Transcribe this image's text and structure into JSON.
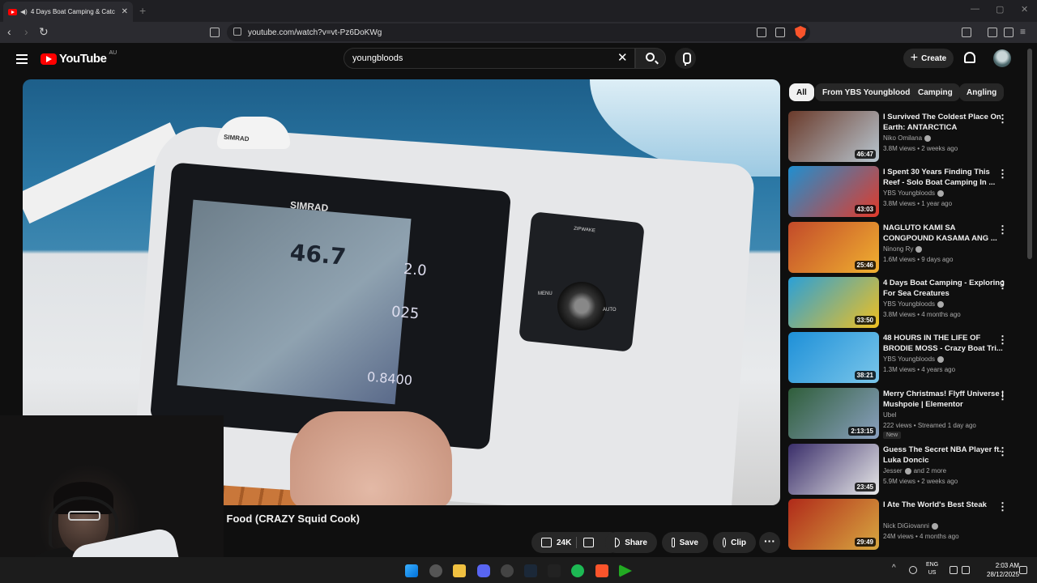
{
  "browser": {
    "tab_title": "4 Days Boat Camping & Catc",
    "url": "youtube.com/watch?v=vt-Pz6DoKWg",
    "new_tab": "+",
    "tab_close": "✕",
    "nav_back": "‹",
    "nav_forward": "›",
    "nav_reload": "↻",
    "win_min": "—",
    "win_max": "▢",
    "win_close": "✕"
  },
  "masthead": {
    "logo_text": "YouTube",
    "region": "AU",
    "search_value": "youngbloods",
    "search_clear": "✕",
    "create_label": "Create",
    "create_plus": "+"
  },
  "player": {
    "display_depth": "46.7",
    "display_speed": "2.0",
    "display_heading": "025",
    "display_value": "0.8400",
    "brand_main": "SIMRAD",
    "brand_dome": "SIMRAD",
    "autopilot_label": "ZIPWAKE",
    "autopilot_menu": "MENU",
    "autopilot_auto": "AUTO"
  },
  "video": {
    "title_visible": "n Food (CRAZY Squid Cook)",
    "like_count": "24K",
    "share_label": "Share",
    "save_label": "Save",
    "clip_label": "Clip",
    "more_label": "···"
  },
  "chips": [
    "All",
    "From YBS Youngbloods",
    "Camping",
    "Angling"
  ],
  "recommendations": [
    {
      "title": "I Survived The Coldest Place On Earth: ANTARCTICA",
      "channel": "Niko Omilana",
      "verified": true,
      "meta": "3.8M views • 2 weeks ago",
      "duration": "46:47",
      "thumb_colors": [
        "#6a3a2a",
        "#b8c6d0"
      ]
    },
    {
      "title": "I Spent 30 Years Finding This Reef - Solo Boat Camping In ...",
      "channel": "YBS Youngbloods",
      "verified": true,
      "meta": "3.8M views • 1 year ago",
      "duration": "43:03",
      "thumb_colors": [
        "#1f8fd0",
        "#e23a2a"
      ]
    },
    {
      "title": "NAGLUTO KAMI SA CONGPOUND KASAMA ANG ...",
      "channel": "Ninong Ry",
      "verified": true,
      "meta": "1.6M views • 9 days ago",
      "duration": "25:46",
      "thumb_colors": [
        "#c24a2a",
        "#f0b030"
      ]
    },
    {
      "title": "4 Days Boat Camping - Exploring For Sea Creatures",
      "channel": "YBS Youngbloods",
      "verified": true,
      "meta": "3.8M views • 4 months ago",
      "duration": "33:50",
      "thumb_colors": [
        "#2aa0d8",
        "#f0c020"
      ]
    },
    {
      "title": "48 HOURS IN THE LIFE OF BRODIE MOSS - Crazy Boat Tri...",
      "channel": "YBS Youngbloods",
      "verified": true,
      "meta": "1.3M views • 4 years ago",
      "duration": "38:21",
      "thumb_colors": [
        "#1e90d8",
        "#7ac6ea"
      ]
    },
    {
      "title": "Merry Christmas! Flyff Universe | Mushpoie | Elementor",
      "channel": "Ubel",
      "verified": false,
      "meta": "222 views • Streamed 1 day ago",
      "duration": "2:13:15",
      "badge": "New",
      "thumb_colors": [
        "#2f5e3a",
        "#8aa0c0"
      ]
    },
    {
      "title": "Guess The Secret NBA Player ft. Luka Doncic",
      "channel": "Jesser",
      "verified": true,
      "channel_extra": "and 2 more",
      "meta": "5.9M views • 2 weeks ago",
      "duration": "23:45",
      "thumb_colors": [
        "#3a2e6a",
        "#e8e8e8"
      ]
    },
    {
      "title": "I Ate The World's Best Steak",
      "channel": "Nick DiGiovanni",
      "verified": true,
      "meta": "24M views • 4 months ago",
      "duration": "29:49",
      "thumb_colors": [
        "#b02a1a",
        "#d8a840"
      ]
    }
  ],
  "taskbar": {
    "lang_top": "ENG",
    "lang_bottom": "US",
    "time": "2:03 AM",
    "date": "28/12/2025"
  }
}
